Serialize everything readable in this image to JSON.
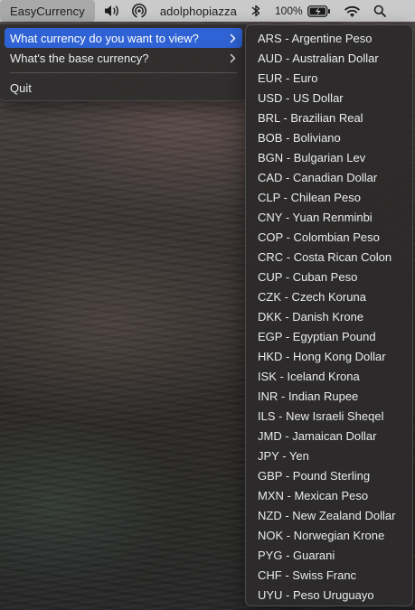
{
  "menubar": {
    "app_title": "EasyCurrency",
    "username": "adolphopiazza",
    "battery_percent": "100%",
    "icons": [
      "speaker-icon",
      "airdrop-icon",
      "bluetooth-icon",
      "battery-charging-icon",
      "wifi-icon",
      "search-icon"
    ]
  },
  "menu": {
    "items": [
      {
        "label": "What currency do you want to view?",
        "has_submenu": true,
        "active": true
      },
      {
        "label": "What's the base currency?",
        "has_submenu": true,
        "active": false
      },
      {
        "label": "Quit",
        "has_submenu": false,
        "active": false
      }
    ]
  },
  "submenu": {
    "items": [
      "ARS - Argentine Peso",
      "AUD - Australian Dollar",
      "EUR - Euro",
      "USD - US Dollar",
      "BRL - Brazilian Real",
      "BOB - Boliviano",
      "BGN - Bulgarian Lev",
      "CAD - Canadian Dollar",
      "CLP - Chilean Peso",
      "CNY - Yuan Renminbi",
      "COP - Colombian Peso",
      "CRC - Costa Rican Colon",
      "CUP - Cuban Peso",
      "CZK - Czech Koruna",
      "DKK - Danish Krone",
      "EGP - Egyptian Pound",
      "HKD - Hong Kong Dollar",
      "ISK - Iceland Krona",
      "INR - Indian Rupee",
      "ILS - New Israeli Sheqel",
      "JMD - Jamaican Dollar",
      "JPY - Yen",
      "GBP - Pound Sterling",
      "MXN - Mexican Peso",
      "NZD - New Zealand Dollar",
      "NOK - Norwegian Krone",
      "PYG - Guarani",
      "CHF - Swiss Franc",
      "UYU - Peso Uruguayo"
    ]
  },
  "colors": {
    "highlight": "#2f62d4",
    "menubar_bg": "#cecece",
    "menu_bg": "#302e2e"
  }
}
